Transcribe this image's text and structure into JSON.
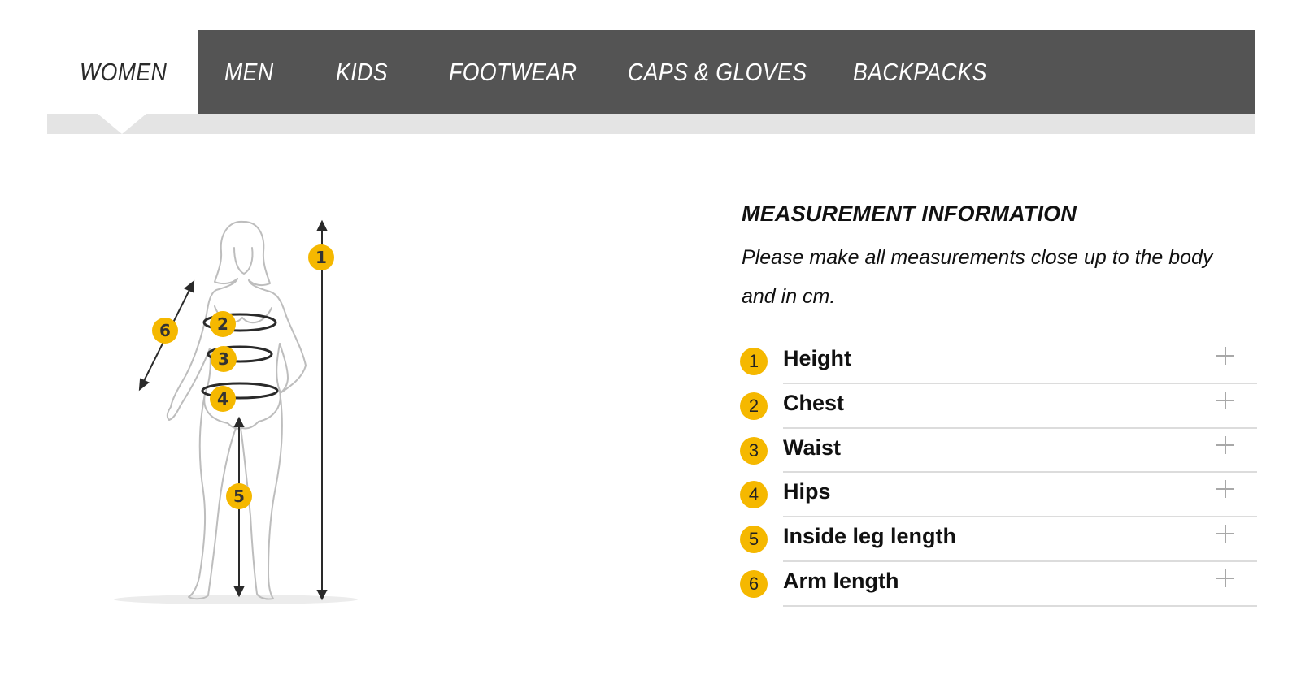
{
  "tabs": [
    {
      "label": "WOMEN",
      "active": true
    },
    {
      "label": "MEN",
      "active": false
    },
    {
      "label": "KIDS",
      "active": false
    },
    {
      "label": "FOOTWEAR",
      "active": false
    },
    {
      "label": "CAPS & GLOVES",
      "active": false
    },
    {
      "label": "BACKPACKS",
      "active": false
    }
  ],
  "figure": {
    "markers": [
      "1",
      "2",
      "3",
      "4",
      "5",
      "6"
    ]
  },
  "info": {
    "title": "MEASUREMENT INFORMATION",
    "description": "Please make all measurements close up to the body and in cm."
  },
  "measurements": [
    {
      "number": "1",
      "label": "Height"
    },
    {
      "number": "2",
      "label": "Chest"
    },
    {
      "number": "3",
      "label": "Waist"
    },
    {
      "number": "4",
      "label": "Hips"
    },
    {
      "number": "5",
      "label": "Inside leg length"
    },
    {
      "number": "6",
      "label": "Arm length"
    }
  ],
  "colors": {
    "tab_bar": "#545454",
    "marker": "#f5b800",
    "strip": "#e4e4e4"
  },
  "icons": {
    "expand": "plus-icon"
  }
}
